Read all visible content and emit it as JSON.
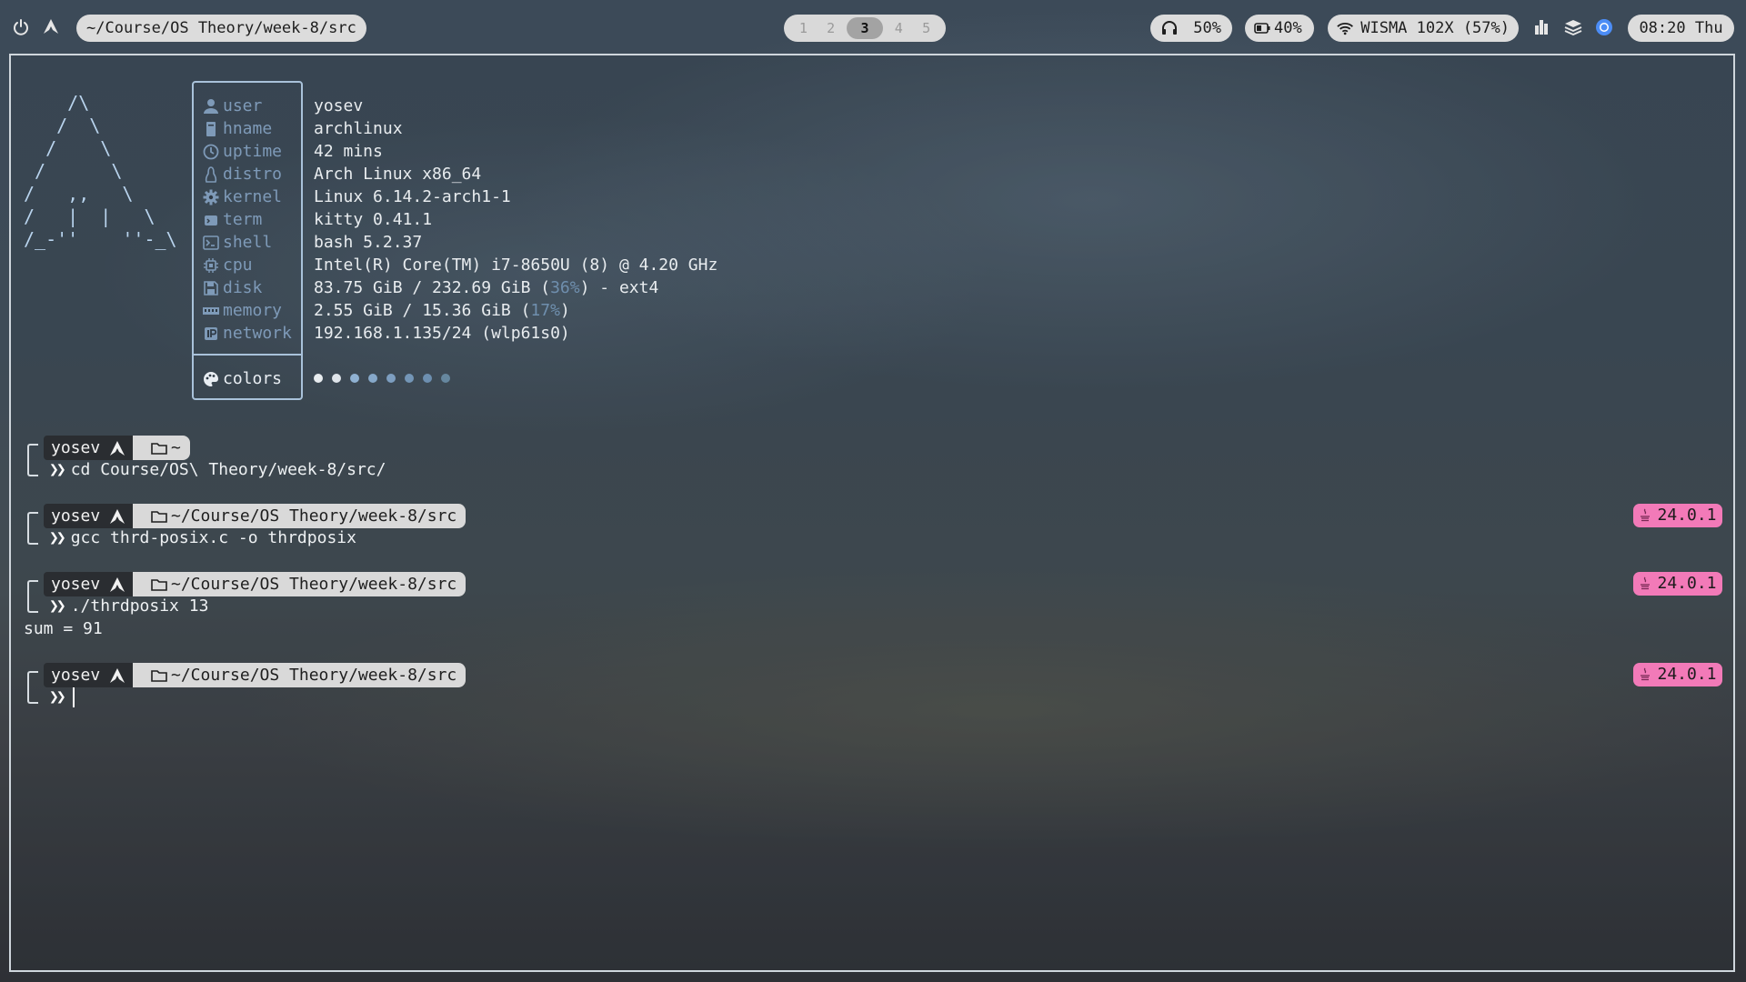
{
  "topbar": {
    "path": "~/Course/OS Theory/week-8/src",
    "workspaces": [
      "1",
      "2",
      "3",
      "4",
      "5"
    ],
    "active_workspace": "3",
    "volume": "50%",
    "battery": "40%",
    "wifi": "WISMA 102X (57%)",
    "clock": "08:20 Thu"
  },
  "fetch": {
    "logo": "    /\\\n   /  \\\n  /    \\\n /      \\\n/   ,,   \\\n/   |  |   \\\n/_-''    ''-_\\",
    "rows": [
      {
        "label": "user",
        "value": "yosev"
      },
      {
        "label": "hname",
        "value": "archlinux"
      },
      {
        "label": "uptime",
        "value": "42 mins"
      },
      {
        "label": "distro",
        "value": "Arch Linux x86_64"
      },
      {
        "label": "kernel",
        "value": "Linux 6.14.2-arch1-1"
      },
      {
        "label": "term",
        "value": "kitty 0.41.1"
      },
      {
        "label": "shell",
        "value": "bash 5.2.37"
      },
      {
        "label": "cpu",
        "value": "Intel(R) Core(TM) i7-8650U (8) @ 4.20 GHz"
      },
      {
        "label": "disk",
        "value_before": "83.75 GiB / 232.69 GiB (",
        "value_hl": "36%",
        "value_after": ") - ext4"
      },
      {
        "label": "memory",
        "value_before": "2.55 GiB / 15.36 GiB (",
        "value_hl": "17%",
        "value_after": ")"
      },
      {
        "label": "network",
        "value": "192.168.1.135/24 (wlp61s0)"
      }
    ],
    "colors_label": "colors",
    "color_dots": [
      "#e8ecef",
      "#dfe4ea",
      "#8fb1d2",
      "#86a8c9",
      "#7d9ec0",
      "#7496b7",
      "#6d8fb0",
      "#66879f"
    ]
  },
  "prompts": [
    {
      "user": "yosev",
      "path": "~",
      "command": "cd Course/OS\\ Theory/week-8/src/",
      "java": ""
    },
    {
      "user": "yosev",
      "path": "~/Course/OS Theory/week-8/src",
      "command": "gcc thrd-posix.c -o thrdposix",
      "java": "24.0.1"
    },
    {
      "user": "yosev",
      "path": "~/Course/OS Theory/week-8/src",
      "command": "./thrdposix 13",
      "java": "24.0.1",
      "output": "sum = 91"
    },
    {
      "user": "yosev",
      "path": "~/Course/OS Theory/week-8/src",
      "command": "",
      "java": "24.0.1"
    }
  ],
  "chevron": "❯❯",
  "colors": {
    "accent_label": "#7e9ab8",
    "border": "#a9c2da",
    "java_badge": "#f27ab8"
  }
}
